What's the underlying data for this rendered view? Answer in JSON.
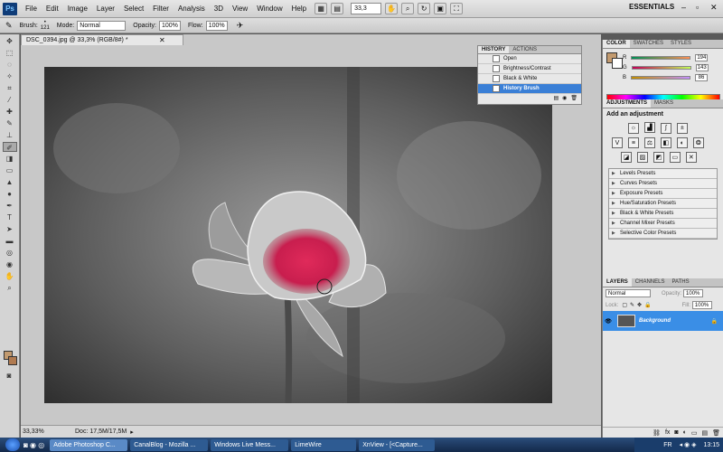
{
  "app": {
    "logo": "Ps",
    "workspace": "ESSENTIALS"
  },
  "menu": [
    "File",
    "Edit",
    "Image",
    "Layer",
    "Select",
    "Filter",
    "Analysis",
    "3D",
    "View",
    "Window",
    "Help"
  ],
  "zoom_combo": "33,3",
  "options": {
    "brush_label": "Brush:",
    "brush_size": "121",
    "mode_label": "Mode:",
    "mode_value": "Normal",
    "opacity_label": "Opacity:",
    "opacity_value": "100%",
    "flow_label": "Flow:",
    "flow_value": "100%"
  },
  "document": {
    "tab_title": "DSC_0394.jpg @ 33,3% (RGB/8#) *",
    "zoom_status": "33,33%",
    "doc_status": "Doc: 17,5M/17,5M"
  },
  "history_panel": {
    "tabs": [
      "HISTORY",
      "ACTIONS"
    ],
    "items": [
      "Open",
      "Brightness/Contrast",
      "Black & White",
      "History Brush"
    ],
    "selected_index": 3
  },
  "color_panel": {
    "tabs": [
      "COLOR",
      "SWATCHES",
      "STYLES"
    ],
    "r_label": "R",
    "r_value": "194",
    "g_label": "G",
    "g_value": "143",
    "b_label": "B",
    "b_value": "86",
    "foreground": "#c29a6f"
  },
  "adjustments_panel": {
    "tabs": [
      "ADJUSTMENTS",
      "MASKS"
    ],
    "title": "Add an adjustment",
    "presets": [
      "Levels Presets",
      "Curves Presets",
      "Exposure Presets",
      "Hue/Saturation Presets",
      "Black & White Presets",
      "Channel Mixer Presets",
      "Selective Color Presets"
    ]
  },
  "layers_panel": {
    "tabs": [
      "LAYERS",
      "CHANNELS",
      "PATHS"
    ],
    "blend_mode": "Normal",
    "opacity_label": "Opacity:",
    "opacity_value": "100%",
    "lock_label": "Lock:",
    "fill_label": "Fill:",
    "fill_value": "100%",
    "layer_name": "Background"
  },
  "taskbar": {
    "items": [
      "Adobe Photoshop C...",
      "CanalBlog - Mozilla ...",
      "Windows Live Mess...",
      "LimeWire",
      "XnView - [<Capture..."
    ],
    "active_index": 0,
    "lang": "FR",
    "clock": "13:15"
  },
  "colors": {
    "accent_selection": "#3a7fd6",
    "highlight_rose": "#d8244e"
  }
}
